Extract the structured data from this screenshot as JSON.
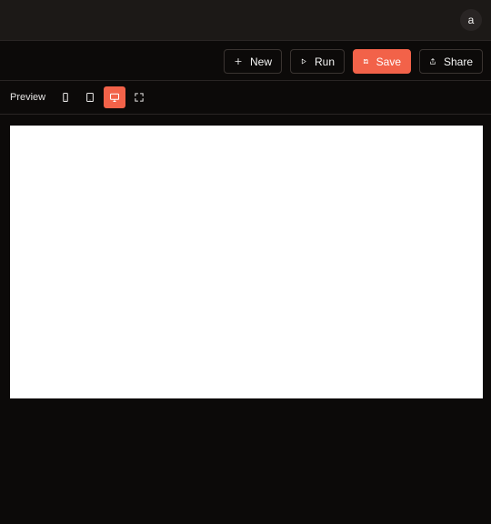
{
  "header": {
    "avatar_initial": "a"
  },
  "toolbar": {
    "new_label": "New",
    "run_label": "Run",
    "save_label": "Save",
    "share_label": "Share"
  },
  "preview": {
    "label": "Preview",
    "active_view": "desktop"
  },
  "colors": {
    "accent": "#f26249",
    "background": "#0c0a09",
    "topbar": "#1c1917"
  }
}
